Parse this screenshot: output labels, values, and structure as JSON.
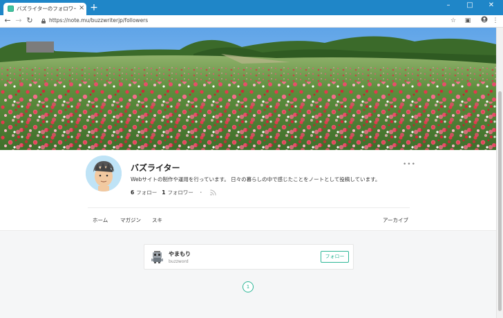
{
  "browser": {
    "tab_title": "バズライターのフォロワー一覧｜note",
    "tab_close": "×",
    "new_tab": "+",
    "url": "https://note.mu/buzzwriterjp/followers",
    "nav_icons": [
      "back-icon",
      "forward-icon",
      "reload-icon"
    ],
    "toolbar_icons": [
      "star-icon",
      "cast-icon",
      "account-icon",
      "menu-icon"
    ],
    "window_controls": [
      "minimize-icon",
      "maximize-icon",
      "close-icon"
    ]
  },
  "profile": {
    "name": "バズライター",
    "description": "Webサイトの制作や運用を行っています。 日々の暮らしの中で感じたことをノートとして投稿しています。",
    "following_count": "6",
    "following_label": "フォロー",
    "followers_count": "1",
    "followers_label": "フォロワー",
    "separator": "・",
    "more": "•••"
  },
  "nav": {
    "home": "ホーム",
    "magazine": "マガジン",
    "likes": "スキ",
    "archive": "アーカイブ"
  },
  "followers": [
    {
      "name": "やまもり",
      "id": "buzzword",
      "button": "フォロー"
    }
  ],
  "pagination": {
    "current": "1"
  },
  "colors": {
    "accent": "#2cb696",
    "titlebar": "#1f86c8"
  }
}
